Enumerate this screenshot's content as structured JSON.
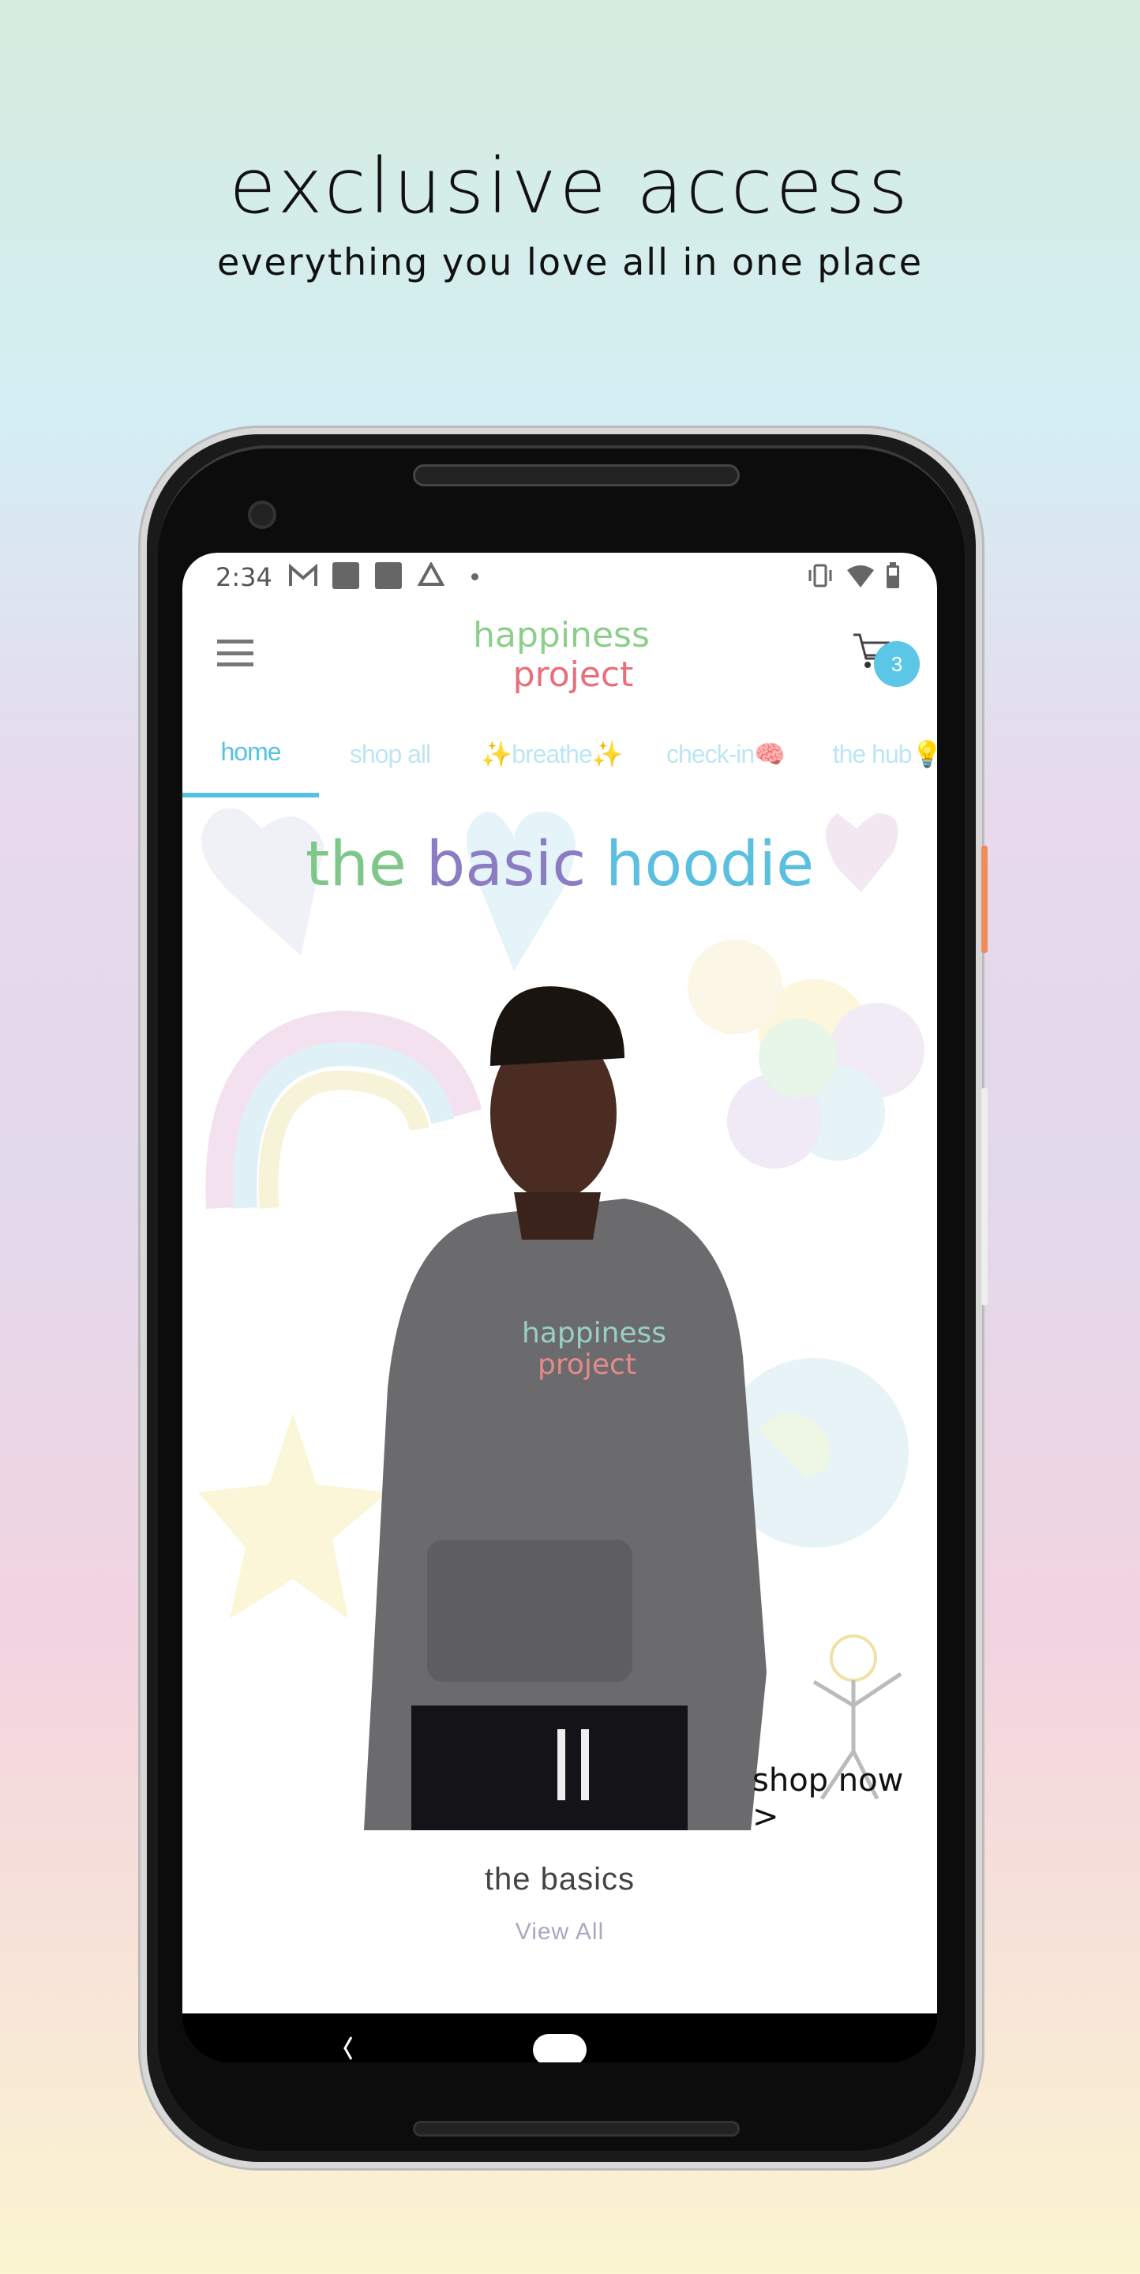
{
  "promo": {
    "title": "exclusive access",
    "subtitle": "everything you love all in one place"
  },
  "status_bar": {
    "time": "2:34",
    "icons": [
      "gmail-icon",
      "app-icon",
      "app-icon",
      "drive-icon",
      "dot-icon",
      "vibrate-icon",
      "wifi-icon",
      "battery-icon"
    ]
  },
  "header": {
    "logo_line1": "happiness",
    "logo_line2": "project",
    "cart_count": "3"
  },
  "tabs": [
    {
      "label": "home",
      "active": true
    },
    {
      "label": "shop all",
      "active": false
    },
    {
      "label": "✨breathe✨",
      "active": false
    },
    {
      "label": "check-in🧠",
      "active": false
    },
    {
      "label": "the hub💡",
      "active": false
    }
  ],
  "hero": {
    "title_words": [
      "the",
      "basic",
      "hoodie"
    ],
    "shirt_logo_line1": "happiness",
    "shirt_logo_line2": "project",
    "cta": "shop now >"
  },
  "collection": {
    "title": "the basics",
    "link": "View All"
  },
  "colors": {
    "accent": "#56c2e2",
    "tab_inactive": "#bde6f2",
    "badge": "#5bc6e6",
    "view_all": "#a8aac0"
  }
}
